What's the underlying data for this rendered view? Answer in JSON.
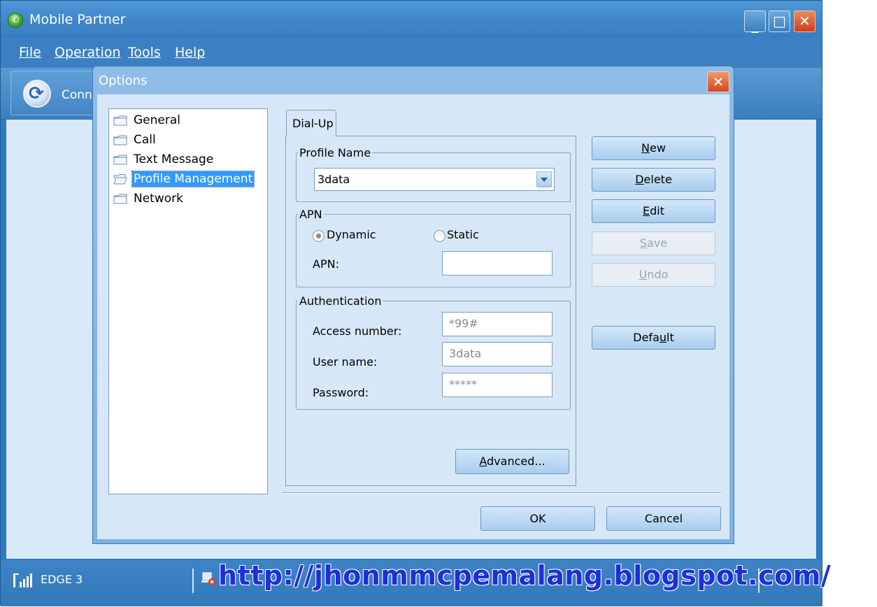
{
  "app": {
    "title": "Mobile Partner",
    "icon": "app-icon"
  },
  "window_controls": {
    "minimize": "_",
    "maximize": "□",
    "close": "✕"
  },
  "menu": {
    "file": "File",
    "operation": "Operation",
    "tools": "Tools",
    "help": "Help"
  },
  "toolbar": {
    "connect_label": "Conne"
  },
  "options": {
    "title": "Options",
    "close_glyph": "✕",
    "tree": [
      {
        "label": "General",
        "icon": "folder-icon",
        "selected": false
      },
      {
        "label": "Call",
        "icon": "folder-icon",
        "selected": false
      },
      {
        "label": "Text Message",
        "icon": "folder-icon",
        "selected": false
      },
      {
        "label": "Profile Management",
        "icon": "folder-open-icon",
        "selected": true
      },
      {
        "label": "Network",
        "icon": "folder-icon",
        "selected": false
      }
    ],
    "tab": "Dial-Up",
    "profile_group": "Profile Name",
    "profile_value": "3data",
    "apn_group": "APN",
    "radio_dynamic": "Dynamic",
    "radio_static": "Static",
    "apn_selected": "Dynamic",
    "apn_label": "APN:",
    "apn_value": "",
    "auth_group": "Authentication",
    "access_label": "Access number:",
    "access_value": "*99#",
    "username_label": "User name:",
    "username_value": "3data",
    "password_label": "Password:",
    "password_value": "*****",
    "advanced": {
      "pre": "",
      "u": "A",
      "post": "dvanced..."
    },
    "buttons": {
      "new": {
        "u": "N",
        "post": "ew"
      },
      "delete": {
        "u": "D",
        "post": "elete"
      },
      "edit": {
        "u": "E",
        "post": "dit"
      },
      "save": {
        "u": "S",
        "post": "ave"
      },
      "undo": {
        "u": "U",
        "post": "ndo"
      },
      "default": {
        "pre": "Defa",
        "u": "u",
        "post": "lt"
      }
    },
    "ok": "OK",
    "cancel": "Cancel"
  },
  "status": {
    "network": "EDGE 3",
    "signal_icon": "signal-bars-icon",
    "pc_icon": "pc-disconnected-icon"
  },
  "watermark": "http://jhonmmcpemalang.blogspot.com/",
  "colors": {
    "window_blue": "#3a80c2",
    "dialog_bg": "#d6e8f7",
    "selection": "#3399ff",
    "watermark": "#1d2fd9"
  }
}
